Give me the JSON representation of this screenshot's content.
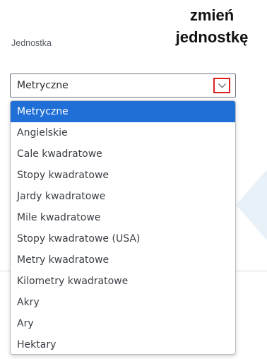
{
  "field": {
    "label": "Jednostka",
    "selected_value": "Metryczne"
  },
  "annotation": {
    "line1": "zmień",
    "line2": "jednostkę"
  },
  "dropdown": {
    "options": [
      "Metryczne",
      "Angielskie",
      "Cale kwadratowe",
      "Stopy kwadratowe",
      "Jardy kwadratowe",
      "Mile kwadratowe",
      "Stopy kwadratowe (USA)",
      "Metry kwadratowe",
      "Kilometry kwadratowe",
      "Akry",
      "Ary",
      "Hektary"
    ],
    "selected_index": 0
  },
  "colors": {
    "selection": "#1f6fd6",
    "highlight_box": "#e02020"
  },
  "icons": {
    "select_toggle": "chevron-down-icon",
    "background_arrow": "chevron-left-icon"
  }
}
